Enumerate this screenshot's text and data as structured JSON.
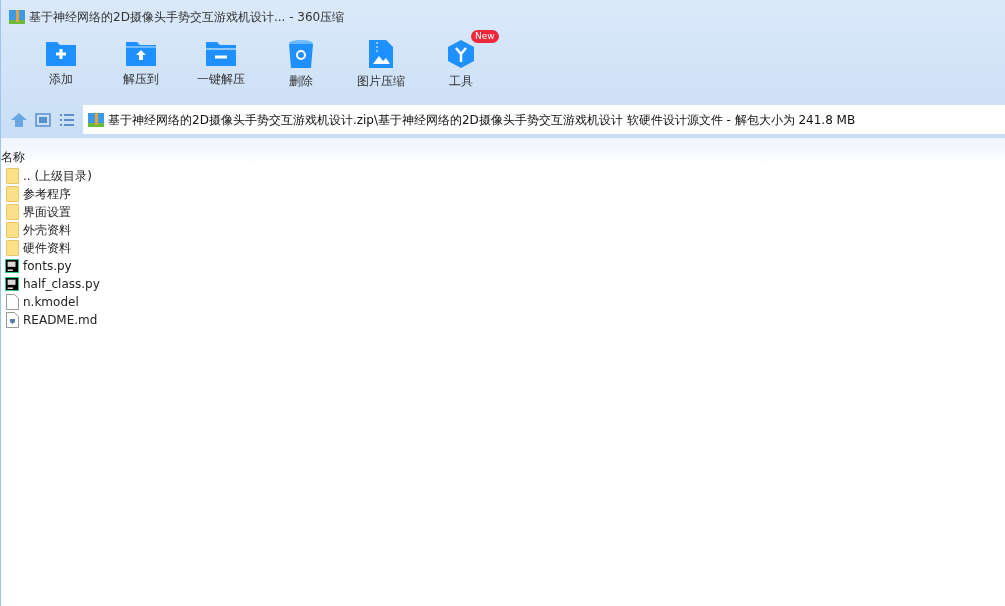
{
  "window": {
    "title": "基于神经网络的2D摄像头手势交互游戏机设计... - 360压缩"
  },
  "toolbar": [
    {
      "kind": "add",
      "label": "添加"
    },
    {
      "kind": "extract_to",
      "label": "解压到"
    },
    {
      "kind": "extract",
      "label": "一键解压"
    },
    {
      "kind": "delete",
      "label": "删除"
    },
    {
      "kind": "image",
      "label": "图片压缩"
    },
    {
      "kind": "tools",
      "label": "工具",
      "badge": "New"
    }
  ],
  "address": {
    "path": "基于神经网络的2D摄像头手势交互游戏机设计.zip\\基于神经网络的2D摄像头手势交互游戏机设计 软硬件设计源文件 - 解包大小为 241.8 MB"
  },
  "list": {
    "columns": [
      "名称"
    ],
    "rows": [
      {
        "kind": "folder",
        "name": ".. (上级目录)"
      },
      {
        "kind": "folder",
        "name": "参考程序"
      },
      {
        "kind": "folder",
        "name": "界面设置"
      },
      {
        "kind": "folder",
        "name": "外壳资料"
      },
      {
        "kind": "folder",
        "name": "硬件资料"
      },
      {
        "kind": "code",
        "name": "fonts.py"
      },
      {
        "kind": "code",
        "name": "half_class.py"
      },
      {
        "kind": "file",
        "name": "n.kmodel"
      },
      {
        "kind": "doc",
        "name": "README.md"
      }
    ]
  }
}
